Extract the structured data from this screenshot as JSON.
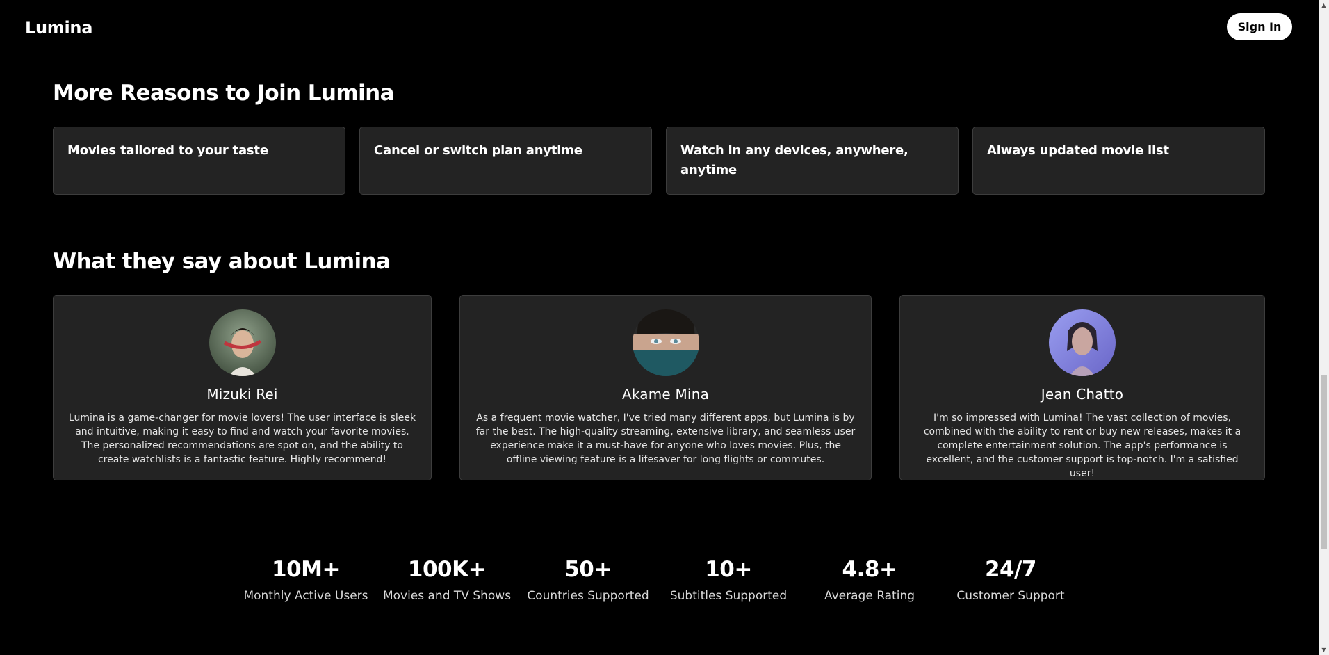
{
  "header": {
    "brand": "Lumina",
    "signin_label": "Sign In"
  },
  "reasons": {
    "title": "More Reasons to Join Lumina",
    "items": [
      "Movies tailored to your taste",
      "Cancel or switch plan anytime",
      "Watch in any devices, anywhere, anytime",
      "Always updated movie list"
    ]
  },
  "testimonials": {
    "title": "What they say about Lumina",
    "items": [
      {
        "name": "Mizuki Rei",
        "text": "Lumina is a game-changer for movie lovers! The user interface is sleek and intuitive, making it easy to find and watch your favorite movies. The personalized recommendations are spot on, and the ability to create watchlists is a fantastic feature. Highly recommend!"
      },
      {
        "name": "Akame Mina",
        "text": "As a frequent movie watcher, I've tried many different apps, but Lumina is by far the best. The high-quality streaming, extensive library, and seamless user experience make it a must-have for anyone who loves movies. Plus, the offline viewing feature is a lifesaver for long flights or commutes."
      },
      {
        "name": "Jean Chatto",
        "text": "I'm so impressed with Lumina! The vast collection of movies, combined with the ability to rent or buy new releases, makes it a complete entertainment solution. The app's performance is excellent, and the customer support is top-notch. I'm a satisfied user!"
      }
    ]
  },
  "stats": [
    {
      "value": "10M+",
      "label": "Monthly Active Users"
    },
    {
      "value": "100K+",
      "label": "Movies and TV Shows"
    },
    {
      "value": "50+",
      "label": "Countries Supported"
    },
    {
      "value": "10+",
      "label": "Subtitles Supported"
    },
    {
      "value": "4.8+",
      "label": "Average Rating"
    },
    {
      "value": "24/7",
      "label": "Customer Support"
    }
  ],
  "colors": {
    "background": "#000000",
    "card": "#232323",
    "card_border": "#3d3d3d",
    "text": "#ffffff",
    "button_bg": "#ffffff",
    "button_text": "#000000"
  }
}
